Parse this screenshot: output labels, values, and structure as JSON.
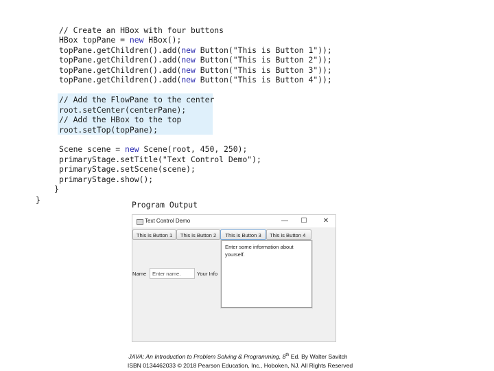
{
  "code": {
    "lines": [
      {
        "parts": [
          {
            "t": "// Create an HBox with four buttons"
          }
        ]
      },
      {
        "parts": [
          {
            "t": "HBox topPane = "
          },
          {
            "t": "new",
            "kw": true
          },
          {
            "t": " HBox();"
          }
        ]
      },
      {
        "parts": [
          {
            "t": "topPane.getChildren().add("
          },
          {
            "t": "new",
            "kw": true
          },
          {
            "t": " Button(\"This is Button 1\"));"
          }
        ]
      },
      {
        "parts": [
          {
            "t": "topPane.getChildren().add("
          },
          {
            "t": "new",
            "kw": true
          },
          {
            "t": " Button(\"This is Button 2\"));"
          }
        ]
      },
      {
        "parts": [
          {
            "t": "topPane.getChildren().add("
          },
          {
            "t": "new",
            "kw": true
          },
          {
            "t": " Button(\"This is Button 3\"));"
          }
        ]
      },
      {
        "parts": [
          {
            "t": "topPane.getChildren().add("
          },
          {
            "t": "new",
            "kw": true
          },
          {
            "t": " Button(\"This is Button 4\"));"
          }
        ]
      },
      {
        "parts": [
          {
            "t": "// Add the FlowPane to the center"
          }
        ]
      },
      {
        "parts": [
          {
            "t": "root.setCenter(centerPane);"
          }
        ]
      },
      {
        "parts": [
          {
            "t": "// Add the HBox to the top"
          }
        ]
      },
      {
        "parts": [
          {
            "t": "root.setTop(topPane);"
          }
        ]
      },
      {
        "parts": [
          {
            "t": "Scene scene = "
          },
          {
            "t": "new",
            "kw": true
          },
          {
            "t": " Scene(root, 450, 250);"
          }
        ]
      },
      {
        "parts": [
          {
            "t": "primaryStage.setTitle(\"Text Control Demo\");"
          }
        ]
      },
      {
        "parts": [
          {
            "t": "primaryStage.setScene(scene);"
          }
        ]
      },
      {
        "parts": [
          {
            "t": "primaryStage.show();"
          }
        ]
      },
      {
        "parts": [
          {
            "t": "}"
          }
        ]
      },
      {
        "parts": [
          {
            "t": "}"
          }
        ]
      }
    ]
  },
  "output_title": "Program Output",
  "window": {
    "title": "Text Control Demo",
    "minimize_glyph": "—",
    "maximize_glyph": "☐",
    "close_glyph": "✕",
    "buttons": [
      "This is Button 1",
      "This is Button 2",
      "This is Button 3",
      "This is Button 4"
    ],
    "textarea_text": "Enter some information about yourself.",
    "name_label": "Name",
    "name_placeholder": "Enter name.",
    "info_label": "Your Info"
  },
  "caption": {
    "line1_title": "JAVA: An Introduction to Problem Solving & Programming, 8",
    "line1_sup": "th",
    "line1_rest": " Ed. By Walter Savitch",
    "line2": "ISBN 0134462033 © 2018 Pearson Education, Inc., Hoboken, NJ. All Rights Reserved"
  },
  "colors": {
    "keyword": "#2b2bb0",
    "highlight": "#dff0fb"
  }
}
